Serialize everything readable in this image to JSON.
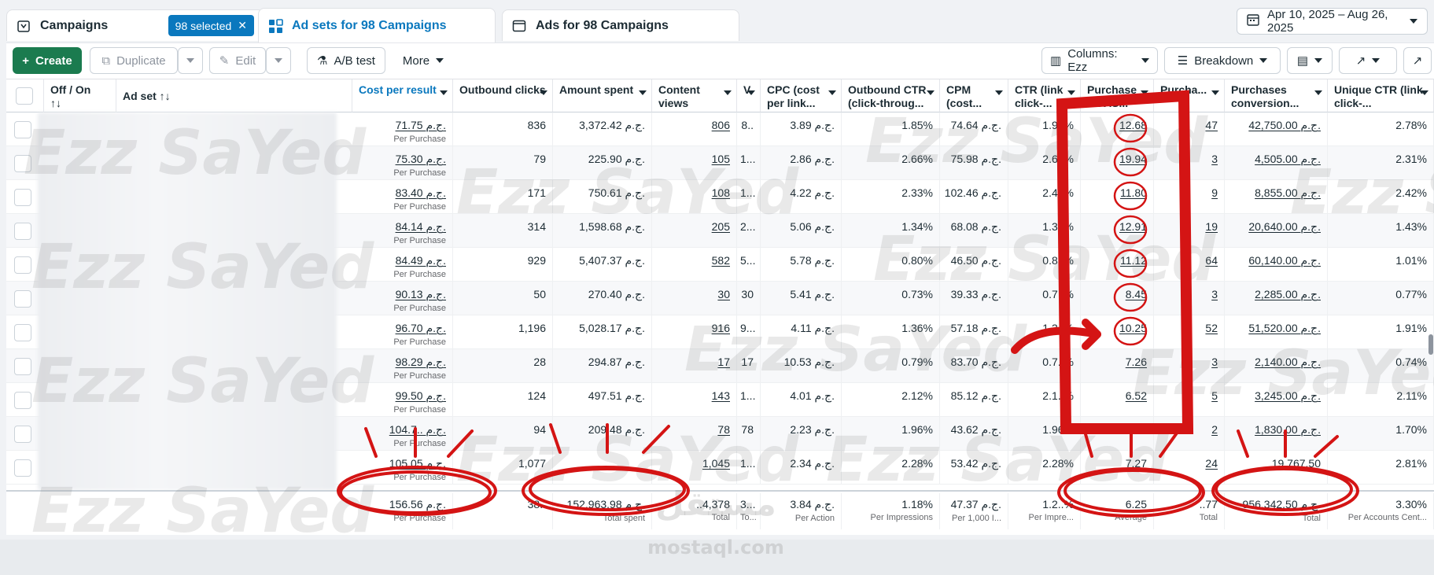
{
  "tabs": {
    "campaigns": {
      "label": "Campaigns",
      "selected_badge": "98 selected"
    },
    "adsets": {
      "label": "Ad sets for 98 Campaigns"
    },
    "ads": {
      "label": "Ads for 98 Campaigns"
    }
  },
  "date_range": "Apr 10, 2025 – Aug 26, 2025",
  "toolbar": {
    "create": "Create",
    "duplicate": "Duplicate",
    "edit": "Edit",
    "ab_test": "A/B test",
    "more": "More",
    "columns": "Columns: Ezz",
    "breakdown": "Breakdown"
  },
  "columns": {
    "off_on": "Off / On",
    "adset": "Ad set",
    "cost_per_result": "Cost per result",
    "outbound_clicks": "Outbound clicks",
    "amount_spent": "Amount spent",
    "content_views": "Content views",
    "col_v": "V",
    "cpc": "CPC (cost per link...",
    "outbound_ctr": "Outbound CTR (click-throug...",
    "cpm": "CPM (cost...",
    "ctr": "CTR (link click-...",
    "purchase_roas": "Purchase ROAS...",
    "purchases": "Purcha...",
    "purchases_conv": "Purchases conversion...",
    "unique_ctr": "Unique CTR (link click-..."
  },
  "rows": [
    {
      "cpr": "71.75 ج.م.",
      "cpr_sub": "Per Purchase",
      "oc": "836",
      "spent": "3,372.42 ج.م.",
      "cv": "806",
      "v": "8..",
      "cpc": "3.89 ج.م.",
      "octr": "1.85%",
      "cpm": "74.64 ج.م.",
      "ctr": "1.9..%",
      "roas": "12.68",
      "pur": "47",
      "pconv": "42,750.00 ج.م.",
      "uctr": "2.78%"
    },
    {
      "cpr": "75.30 ج.م.",
      "cpr_sub": "Per Purchase",
      "oc": "79",
      "spent": "225.90 ج.م.",
      "cv": "105",
      "v": "1...",
      "cpc": "2.86 ج.م.",
      "octr": "2.66%",
      "cpm": "75.98 ج.م.",
      "ctr": "2.6..%",
      "roas": "19.94",
      "pur": "3",
      "pconv": "4,505.00 ج.م.",
      "uctr": "2.31%"
    },
    {
      "cpr": "83.40 ج.م.",
      "cpr_sub": "Per Purchase",
      "oc": "171",
      "spent": "750.61 ج.م.",
      "cv": "108",
      "v": "1...",
      "cpc": "4.22 ج.م.",
      "octr": "2.33%",
      "cpm": "102.46 ج.م.",
      "ctr": "2.4..%",
      "roas": "11.80",
      "pur": "9",
      "pconv": "8,855.00 ج.م.",
      "uctr": "2.42%"
    },
    {
      "cpr": "84.14 ج.م.",
      "cpr_sub": "Per Purchase",
      "oc": "314",
      "spent": "1,598.68 ج.م.",
      "cv": "205",
      "v": "2...",
      "cpc": "5.06 ج.م.",
      "octr": "1.34%",
      "cpm": "68.08 ج.م.",
      "ctr": "1.3..%",
      "roas": "12.91",
      "pur": "19",
      "pconv": "20,640.00 ج.م.",
      "uctr": "1.43%"
    },
    {
      "cpr": "84.49 ج.م.",
      "cpr_sub": "Per Purchase",
      "oc": "929",
      "spent": "5,407.37 ج.م.",
      "cv": "582",
      "v": "5...",
      "cpc": "5.78 ج.م.",
      "octr": "0.80%",
      "cpm": "46.50 ج.م.",
      "ctr": "0.8..%",
      "roas": "11.12",
      "pur": "64",
      "pconv": "60,140.00 ج.م.",
      "uctr": "1.01%"
    },
    {
      "cpr": "90.13 ج.م.",
      "cpr_sub": "Per Purchase",
      "oc": "50",
      "spent": "270.40 ج.م.",
      "cv": "30",
      "v": "30",
      "cpc": "5.41 ج.م.",
      "octr": "0.73%",
      "cpm": "39.33 ج.م.",
      "ctr": "0.7..%",
      "roas": "8.45",
      "pur": "3",
      "pconv": "2,285.00 ج.م.",
      "uctr": "0.77%"
    },
    {
      "cpr": "96.70 ج.م.",
      "cpr_sub": "Per Purchase",
      "oc": "1,196",
      "spent": "5,028.17 ج.م.",
      "cv": "916",
      "v": "9...",
      "cpc": "4.11 ج.م.",
      "octr": "1.36%",
      "cpm": "57.18 ج.م.",
      "ctr": "1.3..%",
      "roas": "10.25",
      "pur": "52",
      "pconv": "51,520.00 ج.م.",
      "uctr": "1.91%"
    },
    {
      "cpr": "98.29 ج.م.",
      "cpr_sub": "Per Purchase",
      "oc": "28",
      "spent": "294.87 ج.م.",
      "cv": "17",
      "v": "17",
      "cpc": "10.53 ج.م.",
      "octr": "0.79%",
      "cpm": "83.70 ج.م.",
      "ctr": "0.7..%",
      "roas": "7.26",
      "pur": "3",
      "pconv": "2,140.00 ج.م.",
      "uctr": "0.74%"
    },
    {
      "cpr": "99.50 ج.م.",
      "cpr_sub": "Per Purchase",
      "oc": "124",
      "spent": "497.51 ج.م.",
      "cv": "143",
      "v": "1...",
      "cpc": "4.01 ج.م.",
      "octr": "2.12%",
      "cpm": "85.12 ج.م.",
      "ctr": "2.1..%",
      "roas": "6.52",
      "pur": "5",
      "pconv": "3,245.00 ج.م.",
      "uctr": "2.11%"
    },
    {
      "cpr": "104.7.. ج.م.",
      "cpr_sub": "Per Purchase",
      "oc": "94",
      "spent": "209.48 ج.م.",
      "cv": "78",
      "v": "78",
      "cpc": "2.23 ج.م.",
      "octr": "1.96%",
      "cpm": "43.62 ج.م.",
      "ctr": "1.96%",
      "roas": "",
      "pur": "2",
      "pconv": "1,830.00 ج.م.",
      "uctr": "1.70%"
    },
    {
      "cpr": "105.05 ج.م.",
      "cpr_sub": "Per Purchase",
      "oc": "1,077",
      "spent": "",
      "cv": "1,045",
      "v": "1...",
      "cpc": "2.34 ج.م.",
      "octr": "2.28%",
      "cpm": "53.42 ج.م.",
      "ctr": "2.28%",
      "roas": "7.27",
      "pur": "24",
      "pconv": "19,767.50",
      "uctr": "2.81%"
    }
  ],
  "totals": {
    "cpr": "156.56 ج.م.",
    "cpr_sub": "Per Purchase",
    "oc": "38..",
    "spent": "152,963.98 ج.م.",
    "spent_sub": "Total spent",
    "cv": "..4,378",
    "cv_sub": "Total",
    "v": "3...",
    "v_sub": "To...",
    "cpc": "3.84 ج.م.",
    "cpc_sub": "Per Action",
    "octr": "1.18%",
    "octr_sub": "Per Impressions",
    "cpm": "47.37 ج.م.",
    "cpm_sub": "Per 1,000 I...",
    "ctr": "1.2..%",
    "ctr_sub": "Per Impre...",
    "roas": "6.25",
    "roas_sub": "Average",
    "pur": "..77",
    "pur_sub": "Total",
    "pconv": "956,342.50 ج.م.",
    "pconv_sub": "Total",
    "uctr": "3.30%",
    "uctr_sub": "Per Accounts Cent..."
  },
  "watermarks": {
    "name": "Ezz SaYed",
    "logo_text": "mostaql.com",
    "logo_ar": "مستقل"
  },
  "colors": {
    "accent": "#0a78be",
    "create_green": "#1b7b4f",
    "annotation_red": "#d41414"
  },
  "icons": [
    "campaign-icon",
    "adsets-grid-icon",
    "ads-icon",
    "calendar-icon",
    "plus-icon",
    "duplicate-icon",
    "pencil-icon",
    "flask-icon",
    "columns-icon",
    "breakdown-icon",
    "report-icon",
    "export-icon",
    "chart-icon",
    "close-icon"
  ]
}
